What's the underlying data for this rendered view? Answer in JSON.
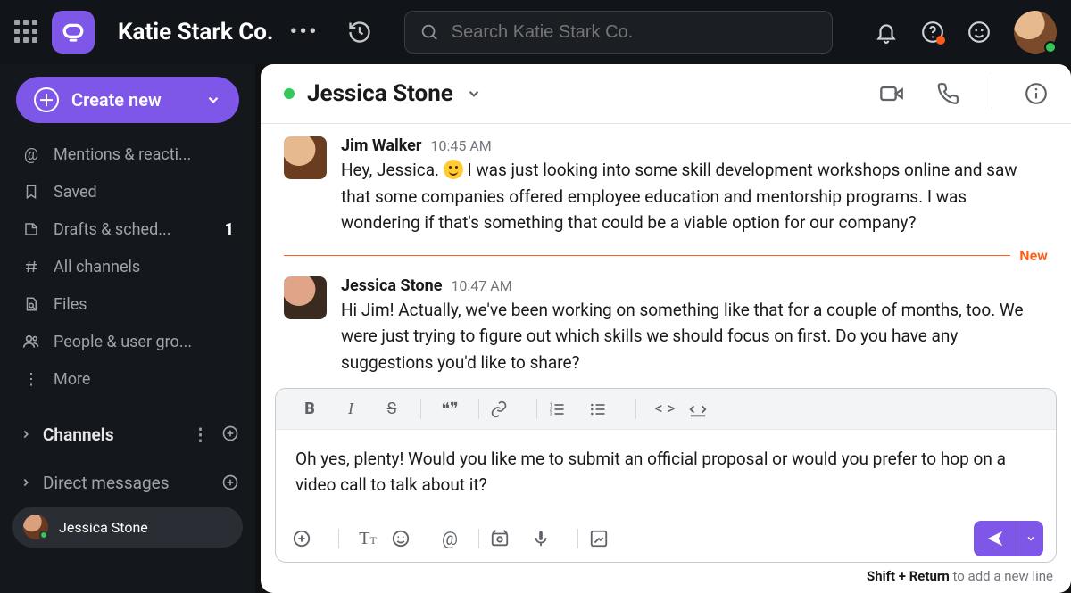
{
  "topbar": {
    "workspace_name": "Katie Stark Co.",
    "search_placeholder": "Search Katie Stark Co."
  },
  "sidebar": {
    "create_label": "Create new",
    "items": [
      {
        "icon": "at",
        "label": "Mentions & reacti..."
      },
      {
        "icon": "bookmark",
        "label": "Saved"
      },
      {
        "icon": "draft",
        "label": "Drafts & sched...",
        "badge": "1"
      },
      {
        "icon": "hash",
        "label": "All channels"
      },
      {
        "icon": "file",
        "label": "Files"
      },
      {
        "icon": "people",
        "label": "People & user gro..."
      },
      {
        "icon": "more",
        "label": "More"
      }
    ],
    "channels_label": "Channels",
    "dm_label": "Direct messages",
    "dm_items": [
      {
        "name": "Jessica Stone",
        "selected": true
      }
    ]
  },
  "chat": {
    "peer_name": "Jessica Stone",
    "messages": [
      {
        "author": "Jim Walker",
        "time": "10:45 AM",
        "pre_emoji": "Hey, Jessica. ",
        "post_emoji": " I was just looking into some skill development workshops online and saw that some companies offered employee education and mentorship programs. I was wondering if that's something that could be a viable option for our company?"
      },
      {
        "author": "Jessica Stone",
        "time": "10:47 AM",
        "text": "Hi Jim! Actually, we've been working on something like that for a couple of months, too. We were just trying to figure out which skills we should focus on first. Do you have any suggestions you'd like to share?"
      }
    ],
    "new_label": "New",
    "compose_text": "Oh yes, plenty! Would you like me to submit an official proposal or would you prefer to hop on a video call to talk about it?",
    "hint_strong": "Shift + Return",
    "hint_rest": " to add a new line"
  }
}
